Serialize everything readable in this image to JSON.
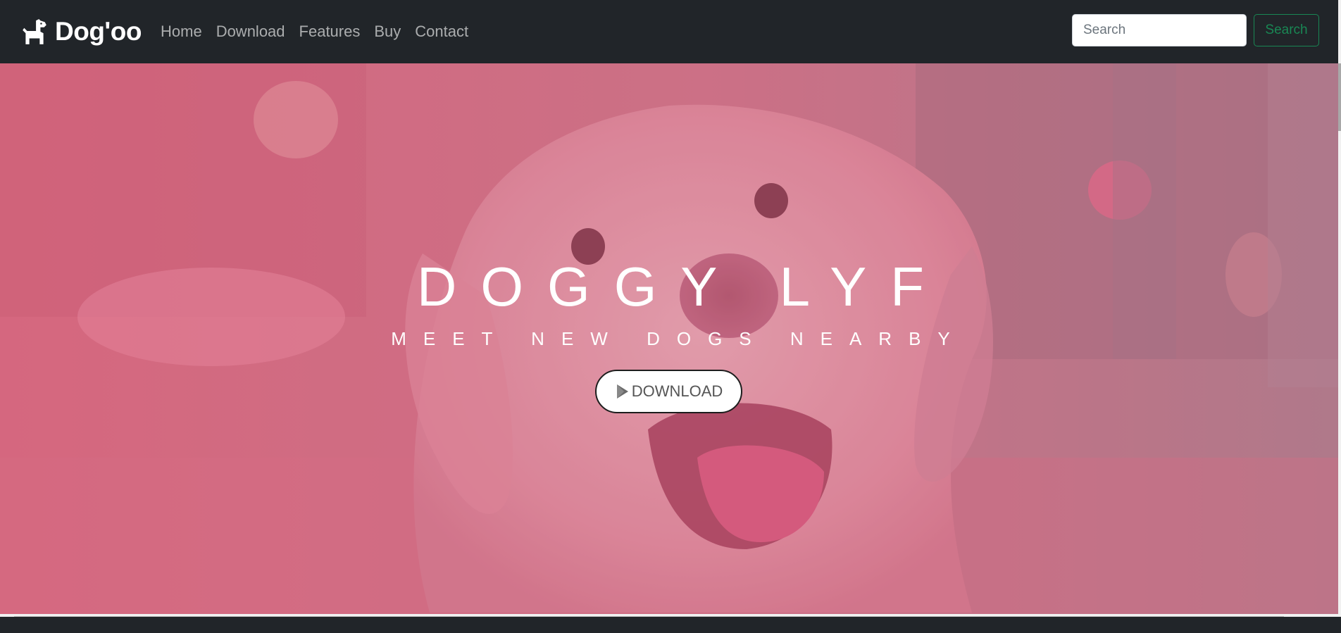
{
  "navbar": {
    "brand": "Dog'oo",
    "brand_icon": "dog-icon",
    "links": [
      "Home",
      "Download",
      "Features",
      "Buy",
      "Contact"
    ],
    "search_placeholder": "Search",
    "search_button": "Search"
  },
  "hero": {
    "title": "DOGGY LYF",
    "subtitle": "MEET NEW DOGS NEARBY",
    "button_label": "DOWNLOAD",
    "button_icon": "play-store-icon"
  },
  "colors": {
    "navbar_bg": "#212529",
    "hero_overlay": "#e0607a",
    "search_button_accent": "#198754"
  }
}
